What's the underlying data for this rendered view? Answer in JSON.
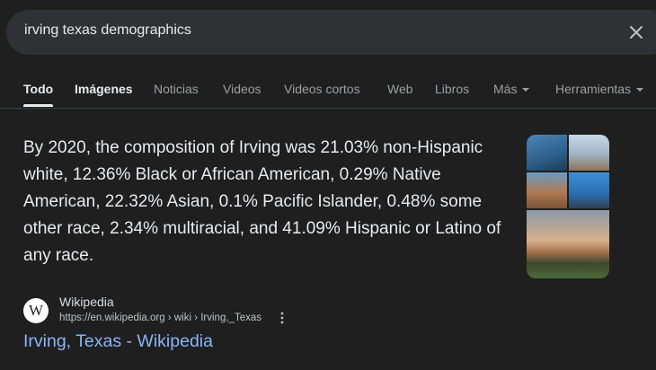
{
  "search": {
    "query": "irving texas demographics",
    "clear_icon": "close-icon"
  },
  "tabs": [
    {
      "label": "Todo",
      "active": true
    },
    {
      "label": "Imágenes"
    },
    {
      "label": "Noticias"
    },
    {
      "label": "Videos"
    },
    {
      "label": "Videos cortos"
    },
    {
      "label": "Web"
    },
    {
      "label": "Libros"
    },
    {
      "label": "Más",
      "dropdown": true
    },
    {
      "label": "Herramientas",
      "dropdown": true
    }
  ],
  "snippet": {
    "text": "By 2020, the composition of Irving was 21.03% non-Hispanic white, 12.36% Black or African American, 0.29% Native American, 22.32% Asian, 0.1% Pacific Islander, 0.48% some other race, 2.34% multiracial, and 41.09% Hispanic or Latino of any race."
  },
  "source": {
    "favicon": "W",
    "site_name": "Wikipedia",
    "url": "https://en.wikipedia.org › wiki › Irving,_Texas",
    "more_icon": "more-vert-icon"
  },
  "result": {
    "title": "Irving, Texas - Wikipedia"
  },
  "colors": {
    "background": "#1f1f1f",
    "search_bar": "#303134",
    "link": "#8ab4f8",
    "text": "#e8eaed",
    "muted": "#9aa0a6"
  }
}
